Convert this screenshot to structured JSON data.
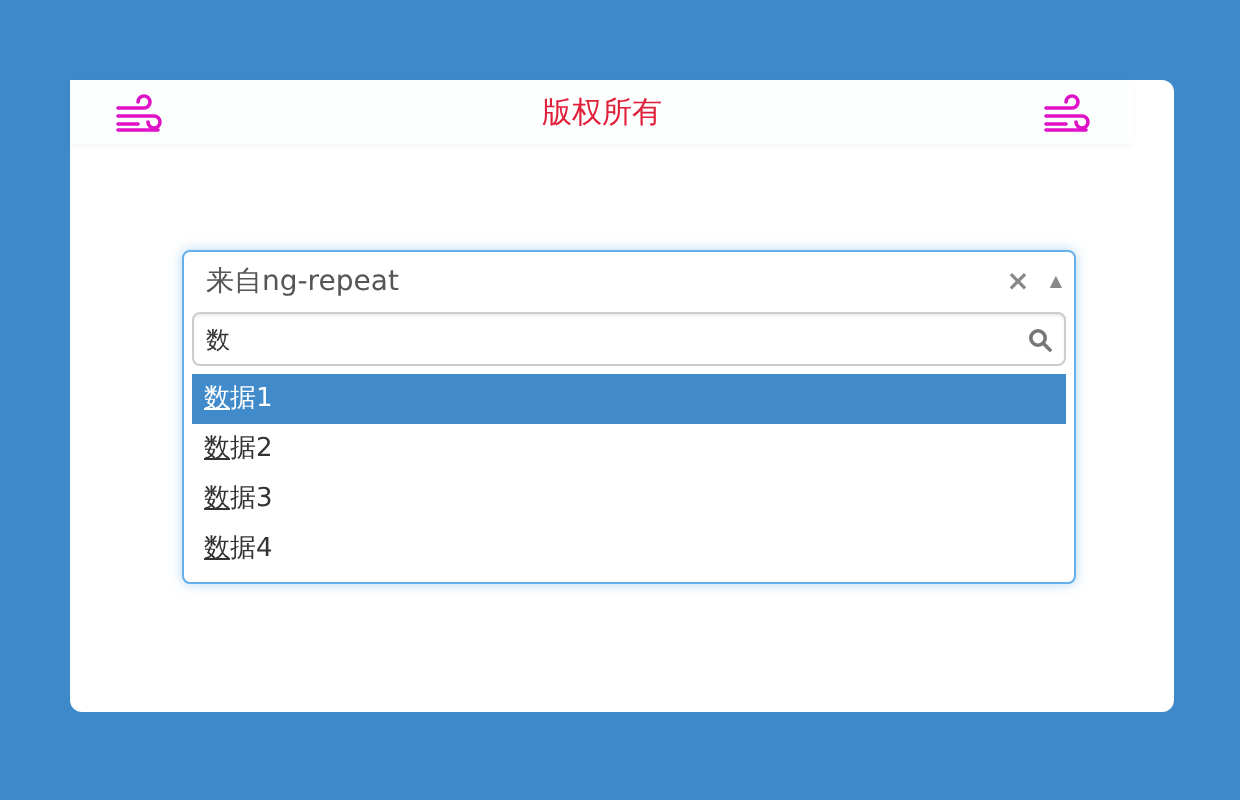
{
  "header": {
    "title": "版权所有"
  },
  "select": {
    "value": "来自ng-repeat",
    "clear": "×",
    "caret": "▲",
    "expanded": true
  },
  "search": {
    "value": "数"
  },
  "options": [
    {
      "label": "数据1",
      "selected": true
    },
    {
      "label": "数据2",
      "selected": false
    },
    {
      "label": "数据3",
      "selected": false
    },
    {
      "label": "数据4",
      "selected": false
    }
  ]
}
